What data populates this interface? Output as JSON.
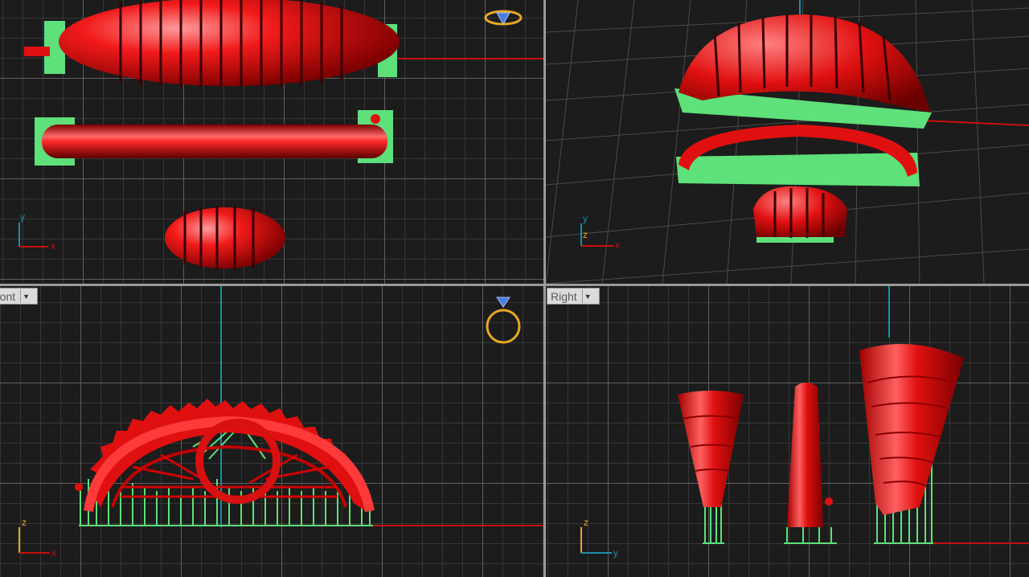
{
  "viewports": {
    "top": {
      "axes": {
        "x": "x",
        "y": "y"
      }
    },
    "perspective": {
      "axes": {
        "x": "x",
        "y": "y",
        "z": "z"
      }
    },
    "front": {
      "title": "Front",
      "title_visible": "ront",
      "axes": {
        "x": "x",
        "z": "z"
      }
    },
    "right": {
      "title": "Right",
      "axes": {
        "y": "y",
        "z": "z"
      }
    }
  },
  "icons": {
    "top": "gem-ring-top-icon",
    "front": "ring-front-icon",
    "dropdown": "chevron-down-icon"
  },
  "colors": {
    "model_red": "#e01010",
    "support_green": "#5ee07a",
    "x_axis": "#c81010",
    "y_axis": "#1a8fa8",
    "grid_major": "#5f5f5f",
    "grid_minor": "#363636",
    "background": "#1c1c1c",
    "icon_gold": "#e5a825"
  }
}
